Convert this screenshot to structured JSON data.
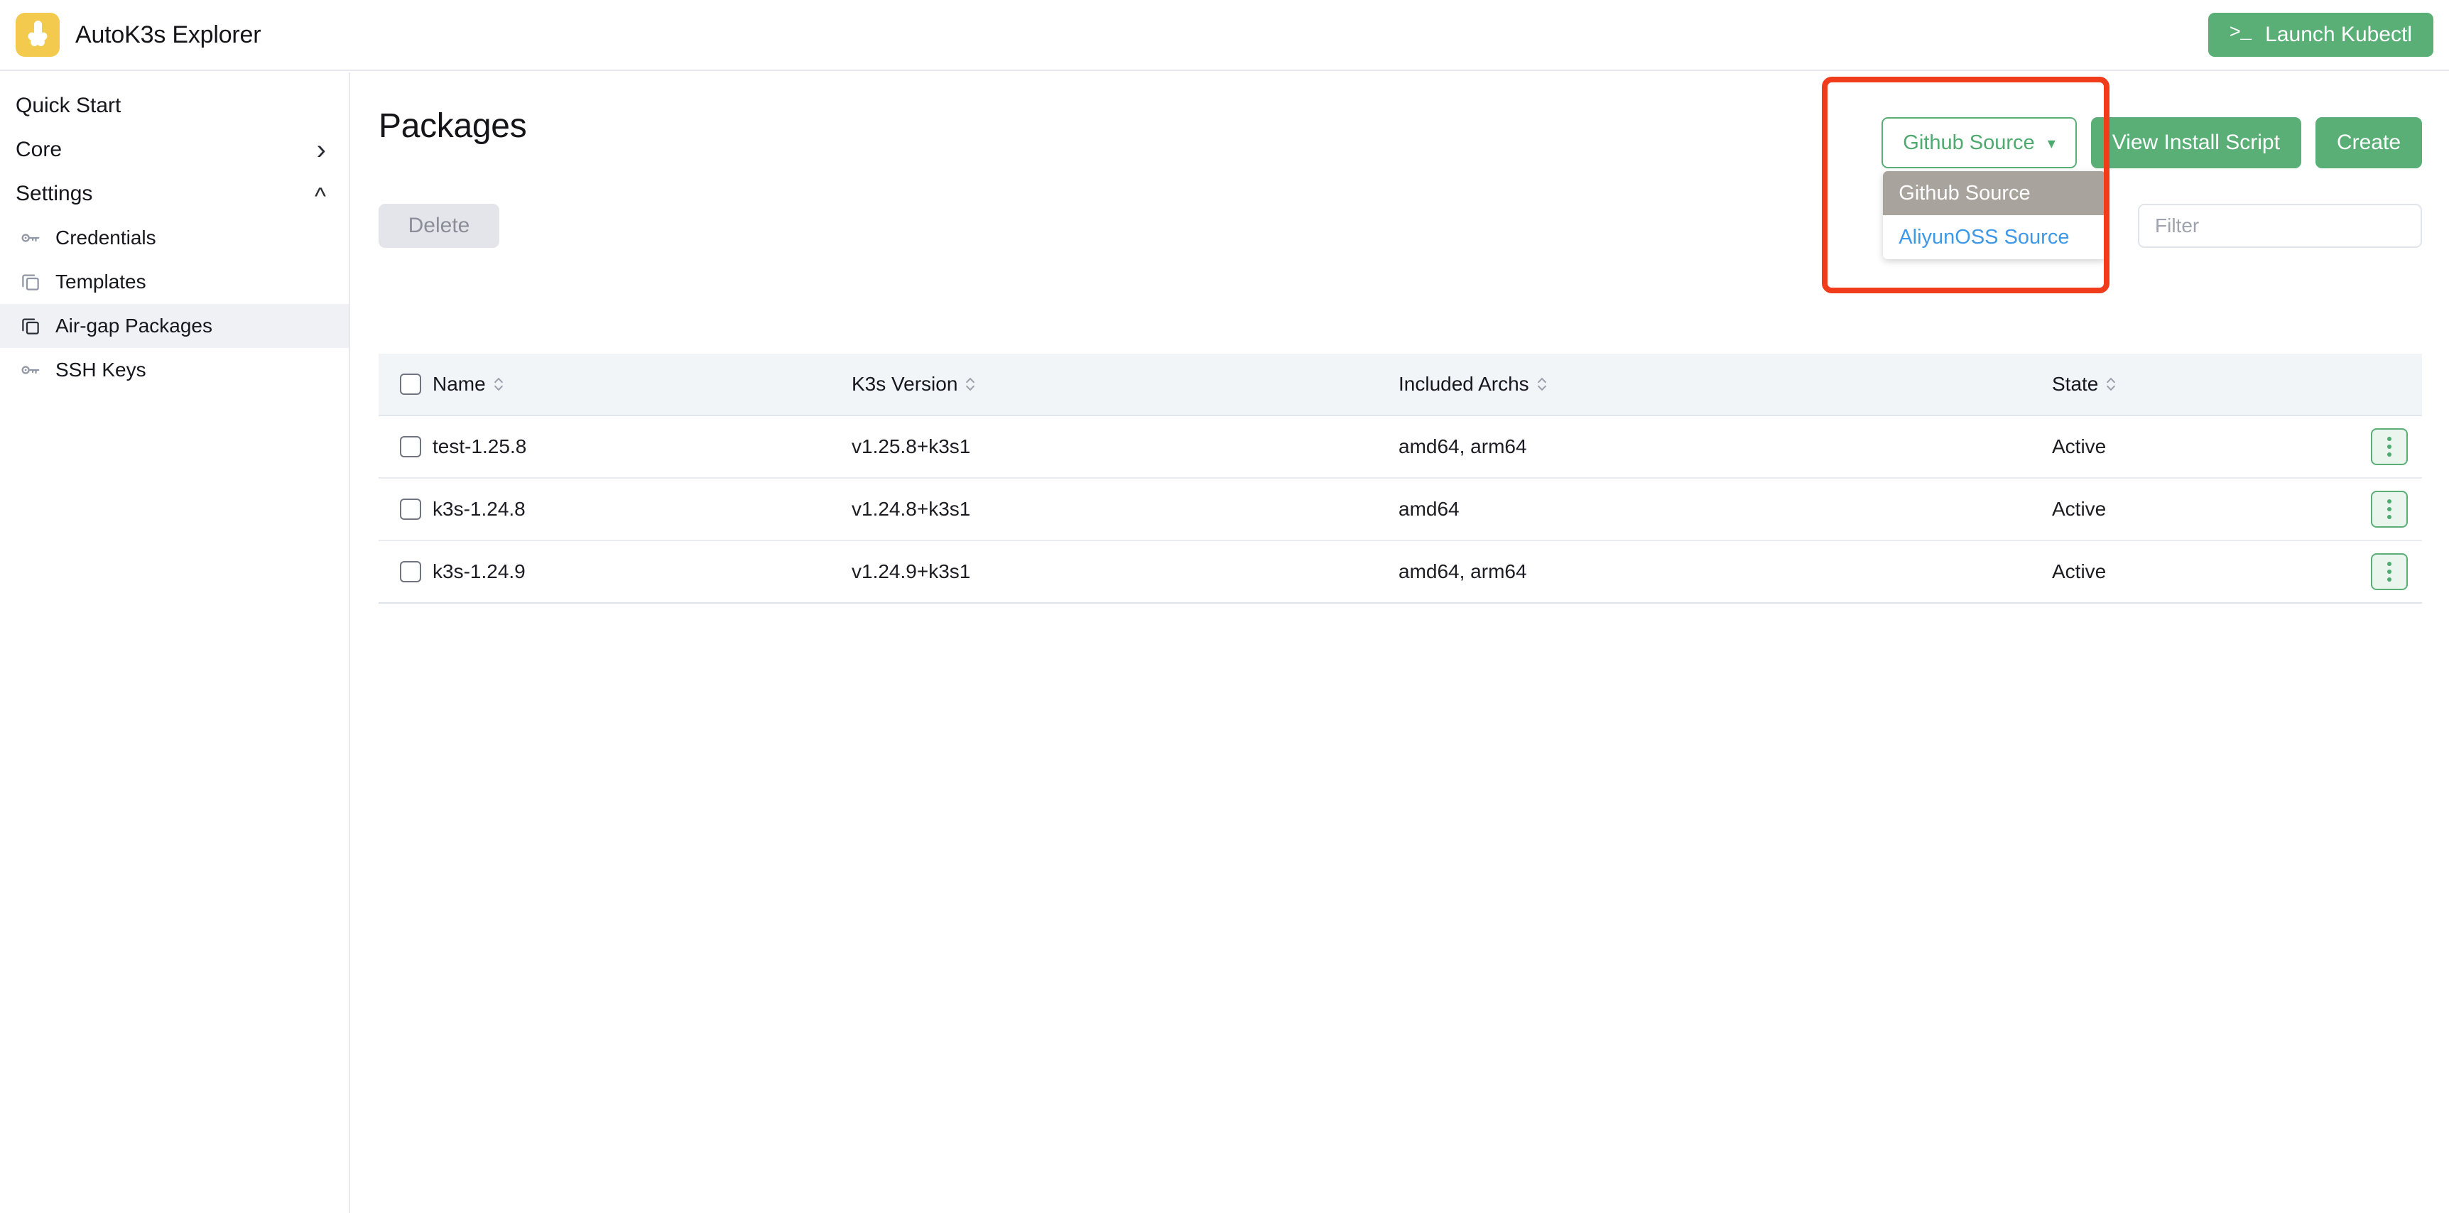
{
  "app": {
    "title": "AutoK3s Explorer",
    "logo_icon": "k3s-logo-icon",
    "launch_button": {
      "label": "Launch Kubectl",
      "icon": "terminal-icon"
    }
  },
  "sidebar": {
    "top_items": [
      {
        "label": "Quick Start",
        "icon": null,
        "chevron": null
      },
      {
        "label": "Core",
        "icon": null,
        "chevron": "chevron-right-icon"
      },
      {
        "label": "Settings",
        "icon": null,
        "chevron": "chevron-up-icon"
      }
    ],
    "sub_items": [
      {
        "label": "Credentials",
        "icon": "key-icon",
        "active": false
      },
      {
        "label": "Templates",
        "icon": "copy-icon",
        "active": false
      },
      {
        "label": "Air-gap Packages",
        "icon": "copy-icon",
        "active": true
      },
      {
        "label": "SSH Keys",
        "icon": "key-icon",
        "active": false
      }
    ]
  },
  "main": {
    "page_title": "Packages",
    "delete_button": "Delete",
    "filter": {
      "value": "",
      "placeholder": "Filter"
    },
    "source_dropdown": {
      "selected": "Github Source",
      "chevron_icon": "chevron-down-icon",
      "open": true,
      "options": [
        {
          "label": "Github Source",
          "selected": true
        },
        {
          "label": "AliyunOSS Source",
          "selected": false
        }
      ]
    },
    "view_install_script_button": "View Install Script",
    "create_button": "Create"
  },
  "table": {
    "columns": [
      {
        "label": "Name",
        "sortable": true
      },
      {
        "label": "K3s Version",
        "sortable": true
      },
      {
        "label": "Included Archs",
        "sortable": true
      },
      {
        "label": "State",
        "sortable": true
      }
    ],
    "rows": [
      {
        "name": "test-1.25.8",
        "version": "v1.25.8+k3s1",
        "archs": "amd64, arm64",
        "state": "Active"
      },
      {
        "name": "k3s-1.24.8",
        "version": "v1.24.8+k3s1",
        "archs": "amd64",
        "state": "Active"
      },
      {
        "name": "k3s-1.24.9",
        "version": "v1.24.9+k3s1",
        "archs": "amd64, arm64",
        "state": "Active"
      }
    ]
  },
  "colors": {
    "brand_yellow": "#f3ca4d",
    "accent_green": "#5aaf77",
    "link_blue": "#3d98e8",
    "highlight_grey": "#a9a39e",
    "annotation_red": "#f13c1c"
  }
}
